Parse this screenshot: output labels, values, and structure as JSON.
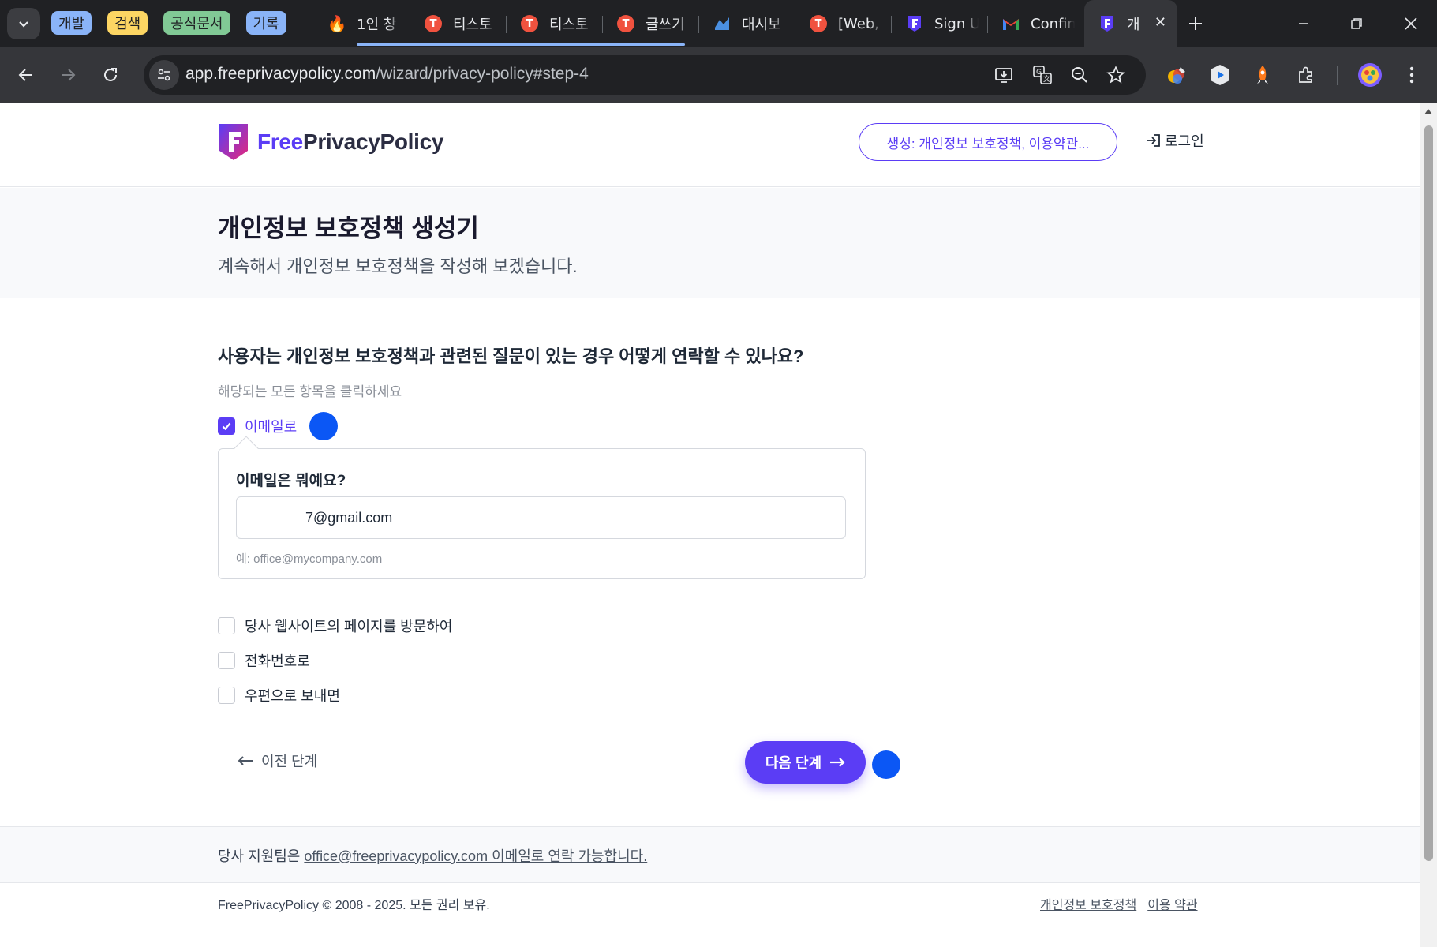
{
  "browser": {
    "tab_groups": [
      {
        "label": "개발",
        "color": "#8ab4f8"
      },
      {
        "label": "검색",
        "color": "#fdd663"
      },
      {
        "label": "공식문서",
        "color": "#81c995"
      },
      {
        "label": "기록",
        "color": "#8ab4f8"
      }
    ],
    "tabs": [
      {
        "title": "1인 창",
        "icon": "fire-icon"
      },
      {
        "title": "티스토",
        "icon": "tistory-icon"
      },
      {
        "title": "티스토",
        "icon": "tistory-icon"
      },
      {
        "title": "글쓰기",
        "icon": "tistory-icon"
      },
      {
        "title": "대시보",
        "icon": "dashboard-icon"
      },
      {
        "title": "[Web,",
        "icon": "tistory-icon"
      },
      {
        "title": "Sign U",
        "icon": "freeprivacypolicy-icon"
      },
      {
        "title": "Confin",
        "icon": "gmail-icon"
      },
      {
        "title": "개",
        "icon": "freeprivacypolicy-icon"
      }
    ],
    "url_host": "app.freeprivacypolicy.com",
    "url_path": "/wizard/privacy-policy#step-4"
  },
  "header": {
    "logo_free": "Free",
    "logo_rest": "PrivacyPolicy",
    "create_button": "생성: 개인정보 보호정책, 이용약관...",
    "login": "로그인"
  },
  "hero": {
    "title": "개인정보 보호정책 생성기",
    "subtitle": "계속해서 개인정보 보호정책을 작성해 보겠습니다."
  },
  "form": {
    "question": "사용자는 개인정보 보호정책과 관련된 질문이 있는 경우 어떻게 연락할 수 있나요?",
    "hint": "해당되는 모든 항목을 클릭하세요",
    "options": [
      {
        "label": "이메일로",
        "checked": true
      },
      {
        "label": "당사 웹사이트의 페이지를 방문하여",
        "checked": false
      },
      {
        "label": "전화번호로",
        "checked": false
      },
      {
        "label": "우편으로 보내면",
        "checked": false
      }
    ],
    "email_question": "이메일은 뭐예요?",
    "email_value": "7@gmail.com",
    "email_example": "예: office@mycompany.com"
  },
  "nav": {
    "prev": "이전 단계",
    "next": "다음 단계"
  },
  "support": {
    "prefix": "당사 지원팀은 ",
    "email": "office@freeprivacypolicy.com",
    "suffix": " 이메일로 연락 가능합니다."
  },
  "footer": {
    "copyright": "FreePrivacyPolicy © 2008 - 2025. 모든 권리 보유.",
    "privacy_link": "개인정보 보호정책",
    "terms_link": "이용 약관"
  },
  "colors": {
    "brand": "#5b3df5",
    "marker": "#0b57f5"
  }
}
